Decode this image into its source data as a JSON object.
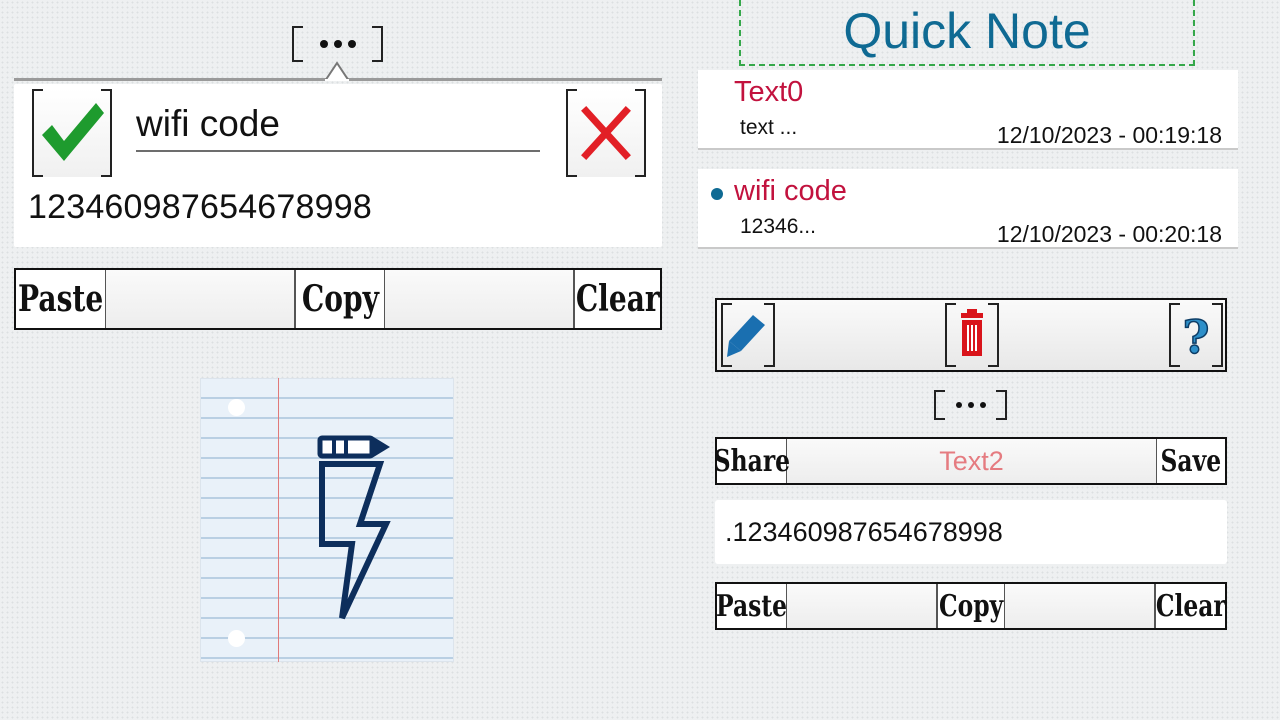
{
  "app": {
    "title": "Quick Note"
  },
  "editor": {
    "title_value": "wifi code",
    "body_text": "12346098765467899​8",
    "confirm_icon": "checkmark-icon",
    "cancel_icon": "close-x-icon",
    "confirm_color": "#1e9b2e",
    "cancel_color": "#e21f26"
  },
  "toolbar_left": {
    "paste": "Paste",
    "copy": "Copy",
    "clear": "Clear"
  },
  "notes": [
    {
      "title": "Text0",
      "snippet": "text ...",
      "date": "12/10/2023 - 00:19:18",
      "selected": false
    },
    {
      "title": "wifi code",
      "snippet": "12346...",
      "date": "12/10/2023 - 00:20:18",
      "selected": true
    }
  ],
  "actions": {
    "edit_icon": "pencil-icon",
    "delete_icon": "trash-icon",
    "help_icon": "question-icon"
  },
  "share_bar": {
    "share": "Share",
    "note_title": "Text2",
    "save": "Save"
  },
  "note_content": ".123460987654678998",
  "toolbar_right": {
    "paste": "Paste",
    "copy": "Copy",
    "clear": "Clear"
  },
  "colors": {
    "accent_blue": "#0f6a93",
    "note_title": "#c2123e",
    "dashed_frame": "#35a84a",
    "share_title": "#e57b80"
  }
}
